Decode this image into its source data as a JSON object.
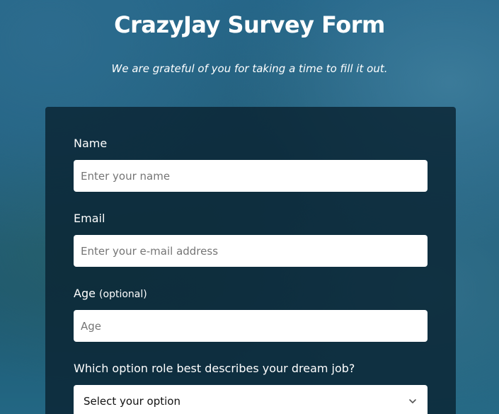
{
  "header": {
    "title": "CrazyJay Survey Form",
    "subtitle": "We are grateful of you for taking a time to fill it out."
  },
  "form": {
    "name": {
      "label": "Name",
      "placeholder": "Enter your name"
    },
    "email": {
      "label": "Email",
      "placeholder": "Enter your e-mail address"
    },
    "age": {
      "label": "Age",
      "optional_note": "(optional)",
      "placeholder": "Age"
    },
    "dream_job": {
      "label": "Which option role best describes your dream job?",
      "selected": "Select your option"
    }
  },
  "colors": {
    "card_background": "#0a2332",
    "text": "#ffffff",
    "field_background": "#ffffff"
  }
}
